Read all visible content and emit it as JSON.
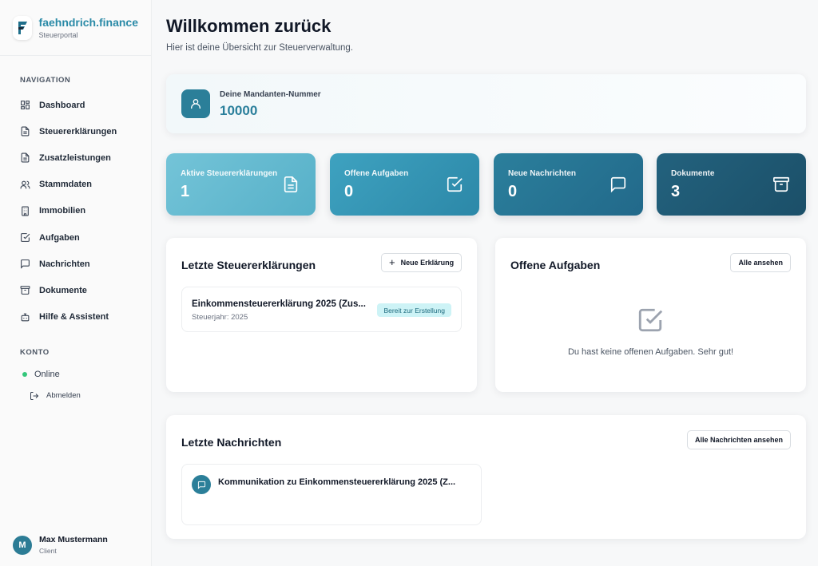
{
  "brand": {
    "name": "faehndrich.finance",
    "subtitle": "Steuerportal"
  },
  "sidebar": {
    "nav_label": "NAVIGATION",
    "items": [
      {
        "label": "Dashboard",
        "icon": "dashboard-icon"
      },
      {
        "label": "Steuererklärungen",
        "icon": "document-icon"
      },
      {
        "label": "Zusatzleistungen",
        "icon": "document-icon"
      },
      {
        "label": "Stammdaten",
        "icon": "users-icon"
      },
      {
        "label": "Immobilien",
        "icon": "building-icon"
      },
      {
        "label": "Aufgaben",
        "icon": "checkbox-icon"
      },
      {
        "label": "Nachrichten",
        "icon": "chat-icon"
      },
      {
        "label": "Dokumente",
        "icon": "archive-icon"
      },
      {
        "label": "Hilfe & Assistent",
        "icon": "bot-icon"
      }
    ],
    "account_label": "KONTO",
    "status": "Online",
    "logout": "Abmelden"
  },
  "user": {
    "initial": "M",
    "name": "Max Mustermann",
    "role": "Client"
  },
  "header": {
    "title": "Willkommen zurück",
    "subtitle": "Hier ist deine Übersicht zur Steuerverwaltung."
  },
  "client": {
    "label": "Deine Mandanten-Nummer",
    "number": "10000"
  },
  "stats": [
    {
      "label": "Aktive Steuererklärungen",
      "value": "1",
      "icon": "document-icon"
    },
    {
      "label": "Offene Aufgaben",
      "value": "0",
      "icon": "checkbox-icon"
    },
    {
      "label": "Neue Nachrichten",
      "value": "0",
      "icon": "chat-icon"
    },
    {
      "label": "Dokumente",
      "value": "3",
      "icon": "archive-icon"
    }
  ],
  "returns": {
    "title": "Letzte Steuererklärungen",
    "button": "Neue Erklärung",
    "items": [
      {
        "title": "Einkommensteuererklärung 2025 (Zus...",
        "year": "Steuerjahr: 2025",
        "status": "Bereit zur Erstellung"
      }
    ]
  },
  "tasks": {
    "title": "Offene Aufgaben",
    "button": "Alle ansehen",
    "empty": "Du hast keine offenen Aufgaben. Sehr gut!"
  },
  "messages": {
    "title": "Letzte Nachrichten",
    "button": "Alle Nachrichten ansehen",
    "items": [
      {
        "title": "Kommunikation zu Einkommensteuererklärung 2025 (Z..."
      }
    ]
  },
  "colors": {
    "accent": "#2a8aa7",
    "online": "#34c77b",
    "badge_bg": "#cdf3f6"
  }
}
